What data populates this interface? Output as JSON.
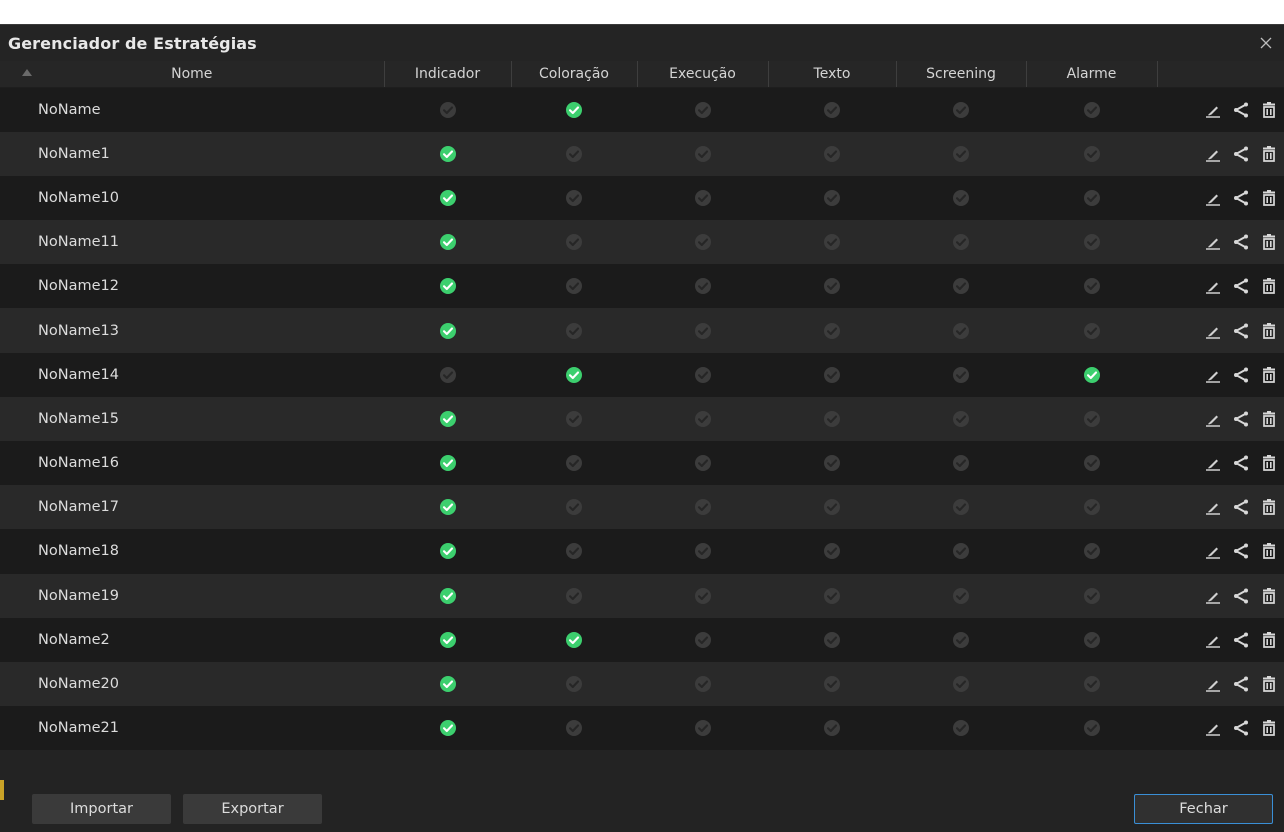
{
  "dialog": {
    "title": "Gerenciador de Estratégias"
  },
  "columns": [
    "Nome",
    "Indicador",
    "Coloração",
    "Execução",
    "Texto",
    "Screening",
    "Alarme",
    ""
  ],
  "rows": [
    {
      "name": "NoName",
      "flags": [
        false,
        true,
        false,
        false,
        false,
        false
      ]
    },
    {
      "name": "NoName1",
      "flags": [
        true,
        false,
        false,
        false,
        false,
        false
      ]
    },
    {
      "name": "NoName10",
      "flags": [
        true,
        false,
        false,
        false,
        false,
        false
      ]
    },
    {
      "name": "NoName11",
      "flags": [
        true,
        false,
        false,
        false,
        false,
        false
      ]
    },
    {
      "name": "NoName12",
      "flags": [
        true,
        false,
        false,
        false,
        false,
        false
      ]
    },
    {
      "name": "NoName13",
      "flags": [
        true,
        false,
        false,
        false,
        false,
        false
      ]
    },
    {
      "name": "NoName14",
      "flags": [
        false,
        true,
        false,
        false,
        false,
        true
      ]
    },
    {
      "name": "NoName15",
      "flags": [
        true,
        false,
        false,
        false,
        false,
        false
      ]
    },
    {
      "name": "NoName16",
      "flags": [
        true,
        false,
        false,
        false,
        false,
        false
      ]
    },
    {
      "name": "NoName17",
      "flags": [
        true,
        false,
        false,
        false,
        false,
        false
      ]
    },
    {
      "name": "NoName18",
      "flags": [
        true,
        false,
        false,
        false,
        false,
        false
      ]
    },
    {
      "name": "NoName19",
      "flags": [
        true,
        false,
        false,
        false,
        false,
        false
      ]
    },
    {
      "name": "NoName2",
      "flags": [
        true,
        true,
        false,
        false,
        false,
        false
      ]
    },
    {
      "name": "NoName20",
      "flags": [
        true,
        false,
        false,
        false,
        false,
        false
      ]
    },
    {
      "name": "NoName21",
      "flags": [
        true,
        false,
        false,
        false,
        false,
        false
      ]
    }
  ],
  "footer": {
    "import_label": "Importar",
    "export_label": "Exportar",
    "close_label": "Fechar"
  },
  "icons": {
    "close": "close-icon",
    "check": "check-circle-icon",
    "edit": "pencil-icon",
    "share": "share-icon",
    "delete": "trash-icon",
    "sort": "sort-ascending-icon"
  },
  "colors": {
    "active_check": "#3ccf6e",
    "inactive_check": "#3c3c3c",
    "accent_border": "#3a8fd6"
  }
}
